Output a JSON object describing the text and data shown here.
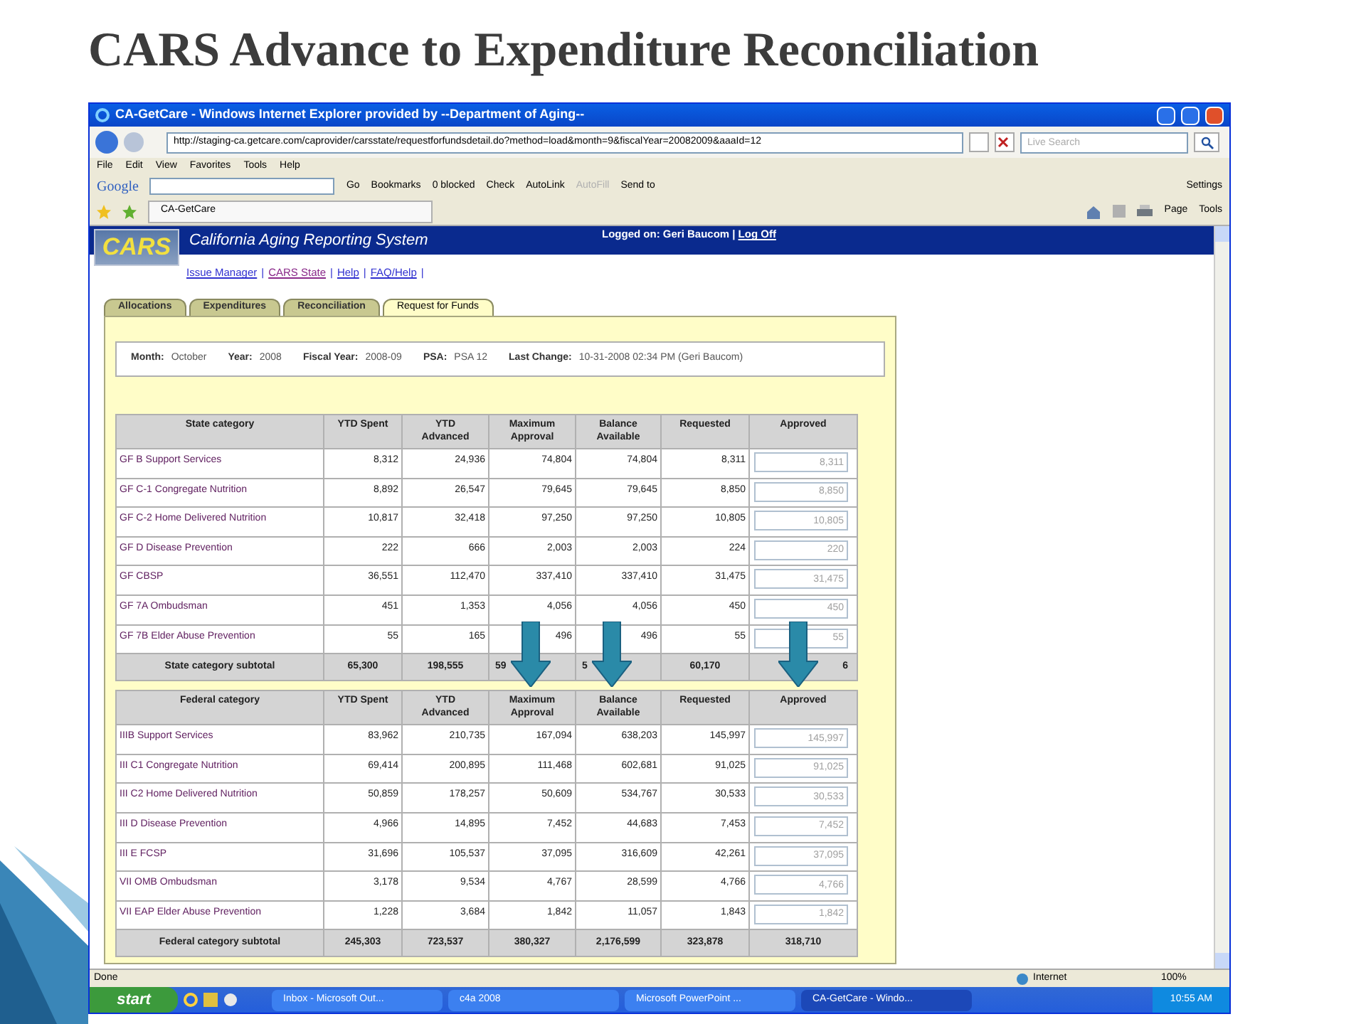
{
  "slide_title": "CARS Advance to Expenditure Reconciliation",
  "window": {
    "title": "CA-GetCare - Windows Internet Explorer provided by --Department of Aging--",
    "address": "http://staging-ca.getcare.com/caprovider/carsstate/requestforfundsdetail.do?method=load&month=9&fiscalYear=20082009&aaaId=12",
    "search_placeholder": "Live Search"
  },
  "menu": [
    "File",
    "Edit",
    "View",
    "Favorites",
    "Tools",
    "Help"
  ],
  "google_logo": "Google",
  "google_toolbar": [
    {
      "label": "Go",
      "disabled": false
    },
    {
      "label": "Bookmarks",
      "disabled": false
    },
    {
      "label": "0 blocked",
      "disabled": false
    },
    {
      "label": "Check",
      "disabled": false
    },
    {
      "label": "AutoLink",
      "disabled": false
    },
    {
      "label": "AutoFill",
      "disabled": true
    },
    {
      "label": "Send to",
      "disabled": false
    },
    {
      "label": "Settings",
      "disabled": false
    }
  ],
  "browser_tab": "CA-GetCare",
  "command_bar": [
    "Page",
    "Tools"
  ],
  "app": {
    "brand": "CARS",
    "system_title": "California Aging Reporting System",
    "logged_on": "Logged on: Geri Baucom |",
    "log_off": "Log Off"
  },
  "links": [
    {
      "label": "Issue Manager",
      "visited": false,
      "separator": "|"
    },
    {
      "label": "CARS State",
      "visited": true,
      "separator": "|"
    },
    {
      "label": "Help",
      "visited": false,
      "separator": "|"
    },
    {
      "label": "FAQ/Help",
      "visited": false,
      "separator": "|"
    }
  ],
  "tabs": [
    {
      "label": "Allocations",
      "selected": false
    },
    {
      "label": "Expenditures",
      "selected": false
    },
    {
      "label": "Reconciliation",
      "selected": false
    },
    {
      "label": "Request for Funds",
      "selected": true
    }
  ],
  "info": [
    {
      "label": "Month:",
      "value": "October"
    },
    {
      "label": "Year:",
      "value": "2008"
    },
    {
      "label": "Fiscal Year:",
      "value": "2008-09"
    },
    {
      "label": "PSA:",
      "value": "PSA 12"
    },
    {
      "label": "Last Change:",
      "value": "10-31-2008 02:34 PM (Geri Baucom)"
    }
  ],
  "tables": [
    {
      "columns": [
        "State category",
        "YTD Spent",
        "YTD Advanced",
        "Maximum Approval",
        "Balance Available",
        "Requested",
        "Approved"
      ],
      "rows": [
        [
          "GF B Support Services",
          "8,312",
          "24,936",
          "74,804",
          "74,804",
          "8,311",
          "8,311"
        ],
        [
          "GF C-1 Congregate Nutrition",
          "8,892",
          "26,547",
          "79,645",
          "79,645",
          "8,850",
          "8,850"
        ],
        [
          "GF C-2 Home Delivered Nutrition",
          "10,817",
          "32,418",
          "97,250",
          "97,250",
          "10,805",
          "10,805"
        ],
        [
          "GF D Disease Prevention",
          "222",
          "666",
          "2,003",
          "2,003",
          "224",
          "220"
        ],
        [
          "GF CBSP",
          "36,551",
          "112,470",
          "337,410",
          "337,410",
          "31,475",
          "31,475"
        ],
        [
          "GF 7A Ombudsman",
          "451",
          "1,353",
          "4,056",
          "4,056",
          "450",
          "450"
        ],
        [
          "GF 7B Elder Abuse Prevention",
          "55",
          "165",
          "496",
          "496",
          "55",
          "55"
        ]
      ],
      "subtotal": [
        "State category subtotal",
        "65,300",
        "198,555",
        "59",
        "5",
        "60,170",
        "6"
      ]
    },
    {
      "columns": [
        "Federal category",
        "YTD Spent",
        "YTD Advanced",
        "Maximum Approval",
        "Balance Available",
        "Requested",
        "Approved"
      ],
      "rows": [
        [
          "IIIB Support Services",
          "83,962",
          "210,735",
          "167,094",
          "638,203",
          "145,997",
          "145,997"
        ],
        [
          "III C1 Congregate Nutrition",
          "69,414",
          "200,895",
          "111,468",
          "602,681",
          "91,025",
          "91,025"
        ],
        [
          "III C2 Home Delivered Nutrition",
          "50,859",
          "178,257",
          "50,609",
          "534,767",
          "30,533",
          "30,533"
        ],
        [
          "III D Disease Prevention",
          "4,966",
          "14,895",
          "7,452",
          "44,683",
          "7,453",
          "7,452"
        ],
        [
          "III E FCSP",
          "31,696",
          "105,537",
          "37,095",
          "316,609",
          "42,261",
          "37,095"
        ],
        [
          "VII OMB Ombudsman",
          "3,178",
          "9,534",
          "4,767",
          "28,599",
          "4,766",
          "4,766"
        ],
        [
          "VII EAP Elder Abuse Prevention",
          "1,228",
          "3,684",
          "1,842",
          "11,057",
          "1,843",
          "1,842"
        ]
      ],
      "subtotal": [
        "Federal category subtotal",
        "245,303",
        "723,537",
        "380,327",
        "2,176,599",
        "323,878",
        "318,710"
      ]
    }
  ],
  "status_bar": {
    "text": "Done",
    "zone": "Internet",
    "zoom": "100%"
  },
  "taskbar": {
    "start": "start",
    "tasks": [
      {
        "label": "Inbox - Microsoft Out...",
        "selected": false
      },
      {
        "label": "c4a 2008",
        "selected": false
      },
      {
        "label": "Microsoft PowerPoint ...",
        "selected": false
      },
      {
        "label": "CA-GetCare - Windo...",
        "selected": true
      }
    ],
    "clock": "10:55 AM"
  }
}
